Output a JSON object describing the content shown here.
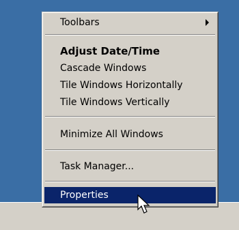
{
  "context_menu": {
    "items": [
      {
        "label": "Toolbars",
        "has_submenu": true
      },
      {
        "label": "Adjust Date/Time",
        "bold": true
      },
      {
        "label": "Cascade Windows"
      },
      {
        "label": "Tile Windows Horizontally"
      },
      {
        "label": "Tile Windows Vertically"
      },
      {
        "label": "Minimize All Windows"
      },
      {
        "label": "Task Manager..."
      },
      {
        "label": "Properties",
        "selected": true
      }
    ]
  },
  "colors": {
    "desktop": "#3a6ea5",
    "menu_face": "#d4d0c8",
    "selection": "#0a246a",
    "selection_text": "#ffffff"
  },
  "icons": {
    "submenu": "right-arrow-icon",
    "pointer": "mouse-cursor-icon"
  }
}
